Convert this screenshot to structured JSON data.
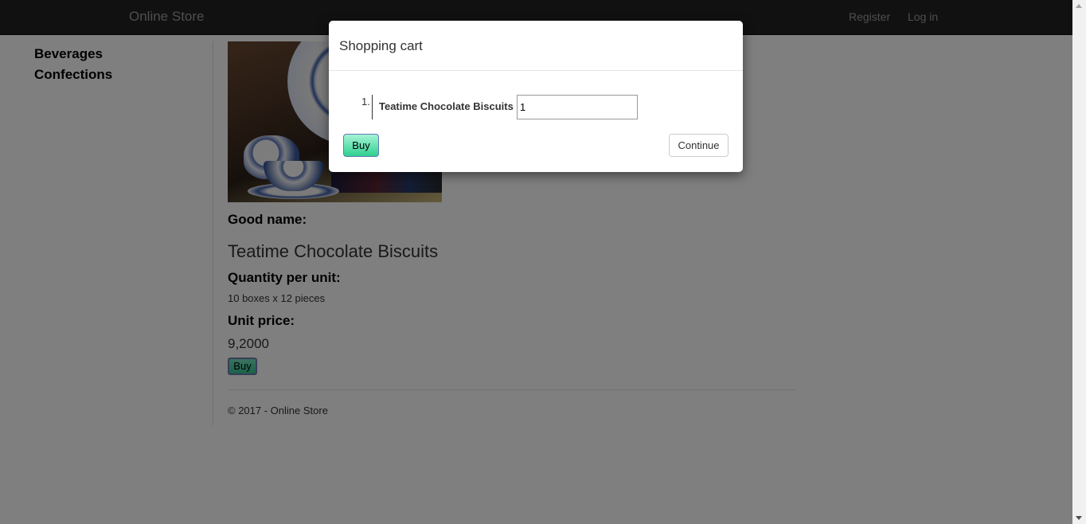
{
  "navbar": {
    "brand": "Online Store",
    "register": "Register",
    "login": "Log in"
  },
  "sidebar": {
    "categories": [
      "Beverages",
      "Confections"
    ]
  },
  "product": {
    "name_label": "Good name:",
    "name": "Teatime Chocolate Biscuits",
    "qty_label": "Quantity per unit:",
    "qty": "10 boxes x 12 pieces",
    "price_label": "Unit price:",
    "price": "9,2000",
    "buy_label": "Buy"
  },
  "footer": {
    "text": "© 2017 - Online Store"
  },
  "modal": {
    "title": "Shopping cart",
    "items": [
      {
        "index": "1.",
        "name": "Teatime Chocolate Biscuits",
        "quantity": "1"
      }
    ],
    "buy_label": "Buy",
    "continue_label": "Continue"
  },
  "colors": {
    "navbar": "#222222",
    "buy_button": "#36c494",
    "overlay": "rgba(0,0,0,0.5)"
  }
}
